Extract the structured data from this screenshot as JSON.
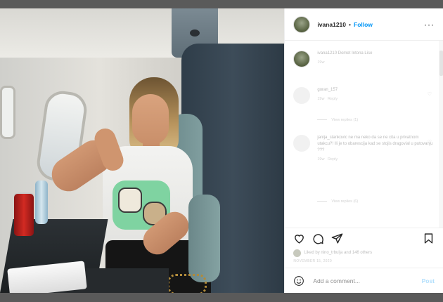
{
  "post": {
    "username": "ivana1210",
    "follow_label": "Follow",
    "separator": "•",
    "more_icon": "more-horizontal-icon"
  },
  "caption": {
    "author": "ivana1210",
    "text": "Domet Intona Lise",
    "time": "19w"
  },
  "comments": [
    {
      "text": "goran_157",
      "time": "19w",
      "reply_label": "Reply",
      "view_replies": "View replies (1)"
    },
    {
      "text": "janija_stankovic ne ma neko da se ne cita u privatnom utakcu?! Ili je to obarescija kad se stojis dragovial u putovanju ???",
      "time": "19w",
      "reply_label": "Reply",
      "view_replies": "View replies (6)"
    }
  ],
  "likes": {
    "text": "Liked by nino_trbulja and 146 others"
  },
  "date": "NOVEMBER 15, 2020",
  "add_comment": {
    "placeholder": "Add a comment...",
    "post_label": "Post"
  },
  "colors": {
    "accent": "#0095f6",
    "post_disabled": "#b2dffc",
    "overlay": "#5a5a5a"
  }
}
